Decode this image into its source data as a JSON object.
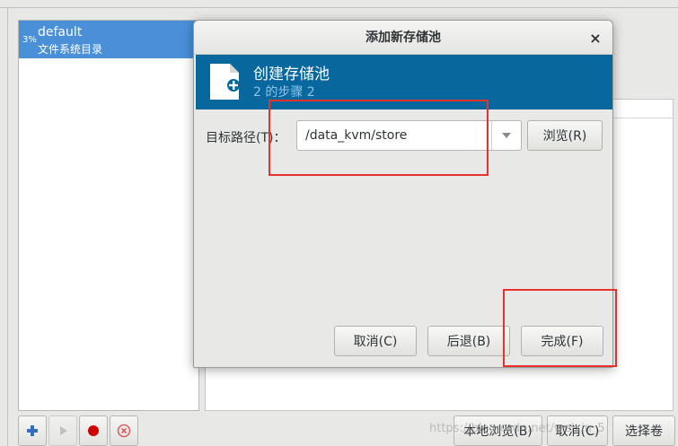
{
  "background": {
    "pool": {
      "usage": "3%",
      "name": "default",
      "type": "文件系统目录"
    },
    "toolbar": {
      "add_icon": "plus-icon",
      "start_icon": "play-icon",
      "stop_icon": "record-icon",
      "delete_icon": "cancel-circle-icon"
    },
    "actions": {
      "browse_local": "本地浏览(B)",
      "cancel": "取消(C)",
      "choose": "选择卷"
    }
  },
  "dialog": {
    "title": "添加新存储池",
    "banner": {
      "title": "创建存储池",
      "step": "2 的步骤 2",
      "color": "#08689e"
    },
    "target_path": {
      "label": "目标路径(T)：",
      "value": "/data_kvm/store"
    },
    "buttons": {
      "browse": "浏览(R)",
      "cancel": "取消(C)",
      "back": "后退(B)",
      "finish": "完成(F)"
    }
  },
  "watermark": "https://blog.csdn.net/weixin_5"
}
